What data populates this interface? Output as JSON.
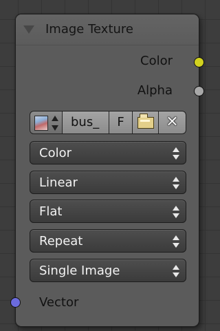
{
  "node": {
    "title": "Image Texture",
    "outputs": [
      {
        "label": "Color",
        "socket_color": "#d2d21f"
      },
      {
        "label": "Alpha",
        "socket_color": "#a8a8a8"
      }
    ],
    "image": {
      "name": "bus_",
      "fake_user_label": "F",
      "unlink_glyph": "✕"
    },
    "properties": [
      {
        "name": "color-space-dropdown",
        "value": "Color"
      },
      {
        "name": "interpolation-dropdown",
        "value": "Linear"
      },
      {
        "name": "projection-dropdown",
        "value": "Flat"
      },
      {
        "name": "extension-dropdown",
        "value": "Repeat"
      },
      {
        "name": "source-dropdown",
        "value": "Single Image"
      }
    ],
    "inputs": [
      {
        "label": "Vector",
        "socket_color": "#6b6bdd"
      }
    ]
  },
  "icons": [
    "collapse-arrow-icon",
    "image-thumbnail-icon",
    "folder-open-icon",
    "close-icon",
    "up-down-arrows-icon"
  ]
}
